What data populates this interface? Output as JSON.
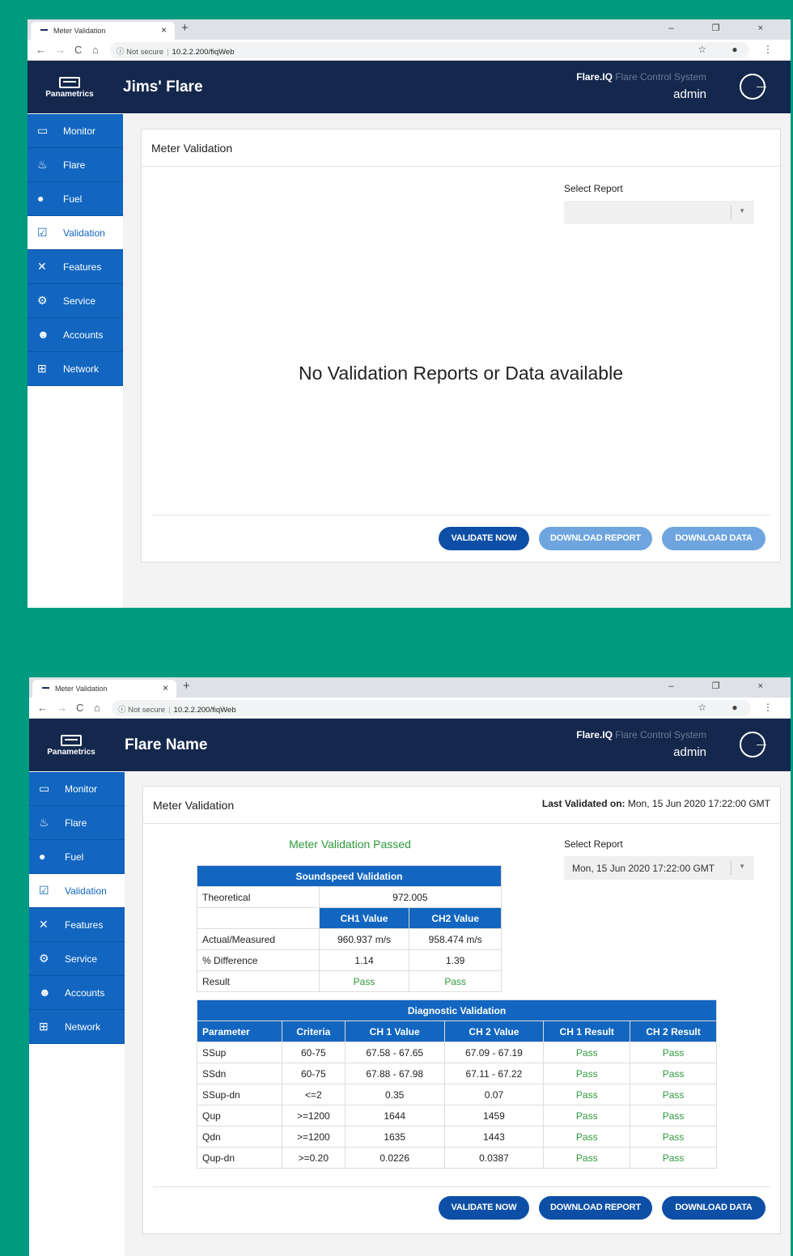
{
  "browser": {
    "tab_title": "Meter Validation",
    "tab_close": "×",
    "new_tab": "+",
    "window_controls": "– ❐ ×",
    "security_label": "Not secure",
    "url": "10.2.2.200/fiqWeb",
    "nav": {
      "back": "←",
      "forward": "→",
      "reload": "C",
      "home": "⌂"
    },
    "addr_icons": "☆ ● ⋮"
  },
  "brand": {
    "name": "Panametrics",
    "product": "Flare.IQ",
    "system": "Flare Control System",
    "user": "admin"
  },
  "sidebar": {
    "items": [
      {
        "label": "Monitor",
        "icon": "monitor-icon",
        "glyph": "▭"
      },
      {
        "label": "Flare",
        "icon": "flame-icon",
        "glyph": "♨"
      },
      {
        "label": "Fuel",
        "icon": "drop-icon",
        "glyph": "●"
      },
      {
        "label": "Validation",
        "icon": "clipboard-check-icon",
        "glyph": "☑"
      },
      {
        "label": "Features",
        "icon": "tools-icon",
        "glyph": "✕"
      },
      {
        "label": "Service",
        "icon": "cogs-icon",
        "glyph": "⚙"
      },
      {
        "label": "Accounts",
        "icon": "users-icon",
        "glyph": "☻"
      },
      {
        "label": "Network",
        "icon": "network-icon",
        "glyph": "⊞"
      }
    ],
    "active": "Validation"
  },
  "screen1": {
    "site_title": "Jims' Flare",
    "card_title": "Meter Validation",
    "select_label": "Select Report",
    "select_value": "",
    "empty_message": "No Validation Reports or Data available",
    "buttons": {
      "validate": "VALIDATE NOW",
      "download_report": "DOWNLOAD REPORT",
      "download_data": "DOWNLOAD DATA"
    }
  },
  "screen2": {
    "site_title": "Flare Name",
    "card_title": "Meter Validation",
    "last_validated_label": "Last Validated on:",
    "last_validated_value": "Mon, 15 Jun 2020 17:22:00 GMT",
    "status": "Meter Validation Passed",
    "select_label": "Select Report",
    "select_value": "Mon, 15 Jun 2020 17:22:00 GMT",
    "soundspeed": {
      "title": "Soundspeed Validation",
      "theoretical_label": "Theoretical",
      "theoretical_value": "972.005",
      "ch1_header": "CH1 Value",
      "ch2_header": "CH2 Value",
      "rows": [
        {
          "label": "Actual/Measured",
          "ch1": "960.937 m/s",
          "ch2": "958.474 m/s"
        },
        {
          "label": "% Difference",
          "ch1": "1.14",
          "ch2": "1.39"
        },
        {
          "label": "Result",
          "ch1": "Pass",
          "ch2": "Pass"
        }
      ]
    },
    "diagnostic": {
      "title": "Diagnostic Validation",
      "headers": [
        "Parameter",
        "Criteria",
        "CH 1 Value",
        "CH 2 Value",
        "CH 1 Result",
        "CH 2 Result"
      ],
      "rows": [
        [
          "SSup",
          "60-75",
          "67.58 - 67.65",
          "67.09 - 67.19",
          "Pass",
          "Pass"
        ],
        [
          "SSdn",
          "60-75",
          "67.88 - 67.98",
          "67.11 - 67.22",
          "Pass",
          "Pass"
        ],
        [
          "SSup-dn",
          "<=2",
          "0.35",
          "0.07",
          "Pass",
          "Pass"
        ],
        [
          "Qup",
          ">=1200",
          "1644",
          "1459",
          "Pass",
          "Pass"
        ],
        [
          "Qdn",
          ">=1200",
          "1635",
          "1443",
          "Pass",
          "Pass"
        ],
        [
          "Qup-dn",
          ">=0.20",
          "0.0226",
          "0.0387",
          "Pass",
          "Pass"
        ]
      ]
    },
    "buttons": {
      "validate": "VALIDATE NOW",
      "download_report": "DOWNLOAD REPORT",
      "download_data": "DOWNLOAD DATA"
    }
  },
  "colors": {
    "navy": "#14284d",
    "blue": "#1266c0",
    "pass_green": "#2f9a3c",
    "background_teal": "#009a80"
  }
}
